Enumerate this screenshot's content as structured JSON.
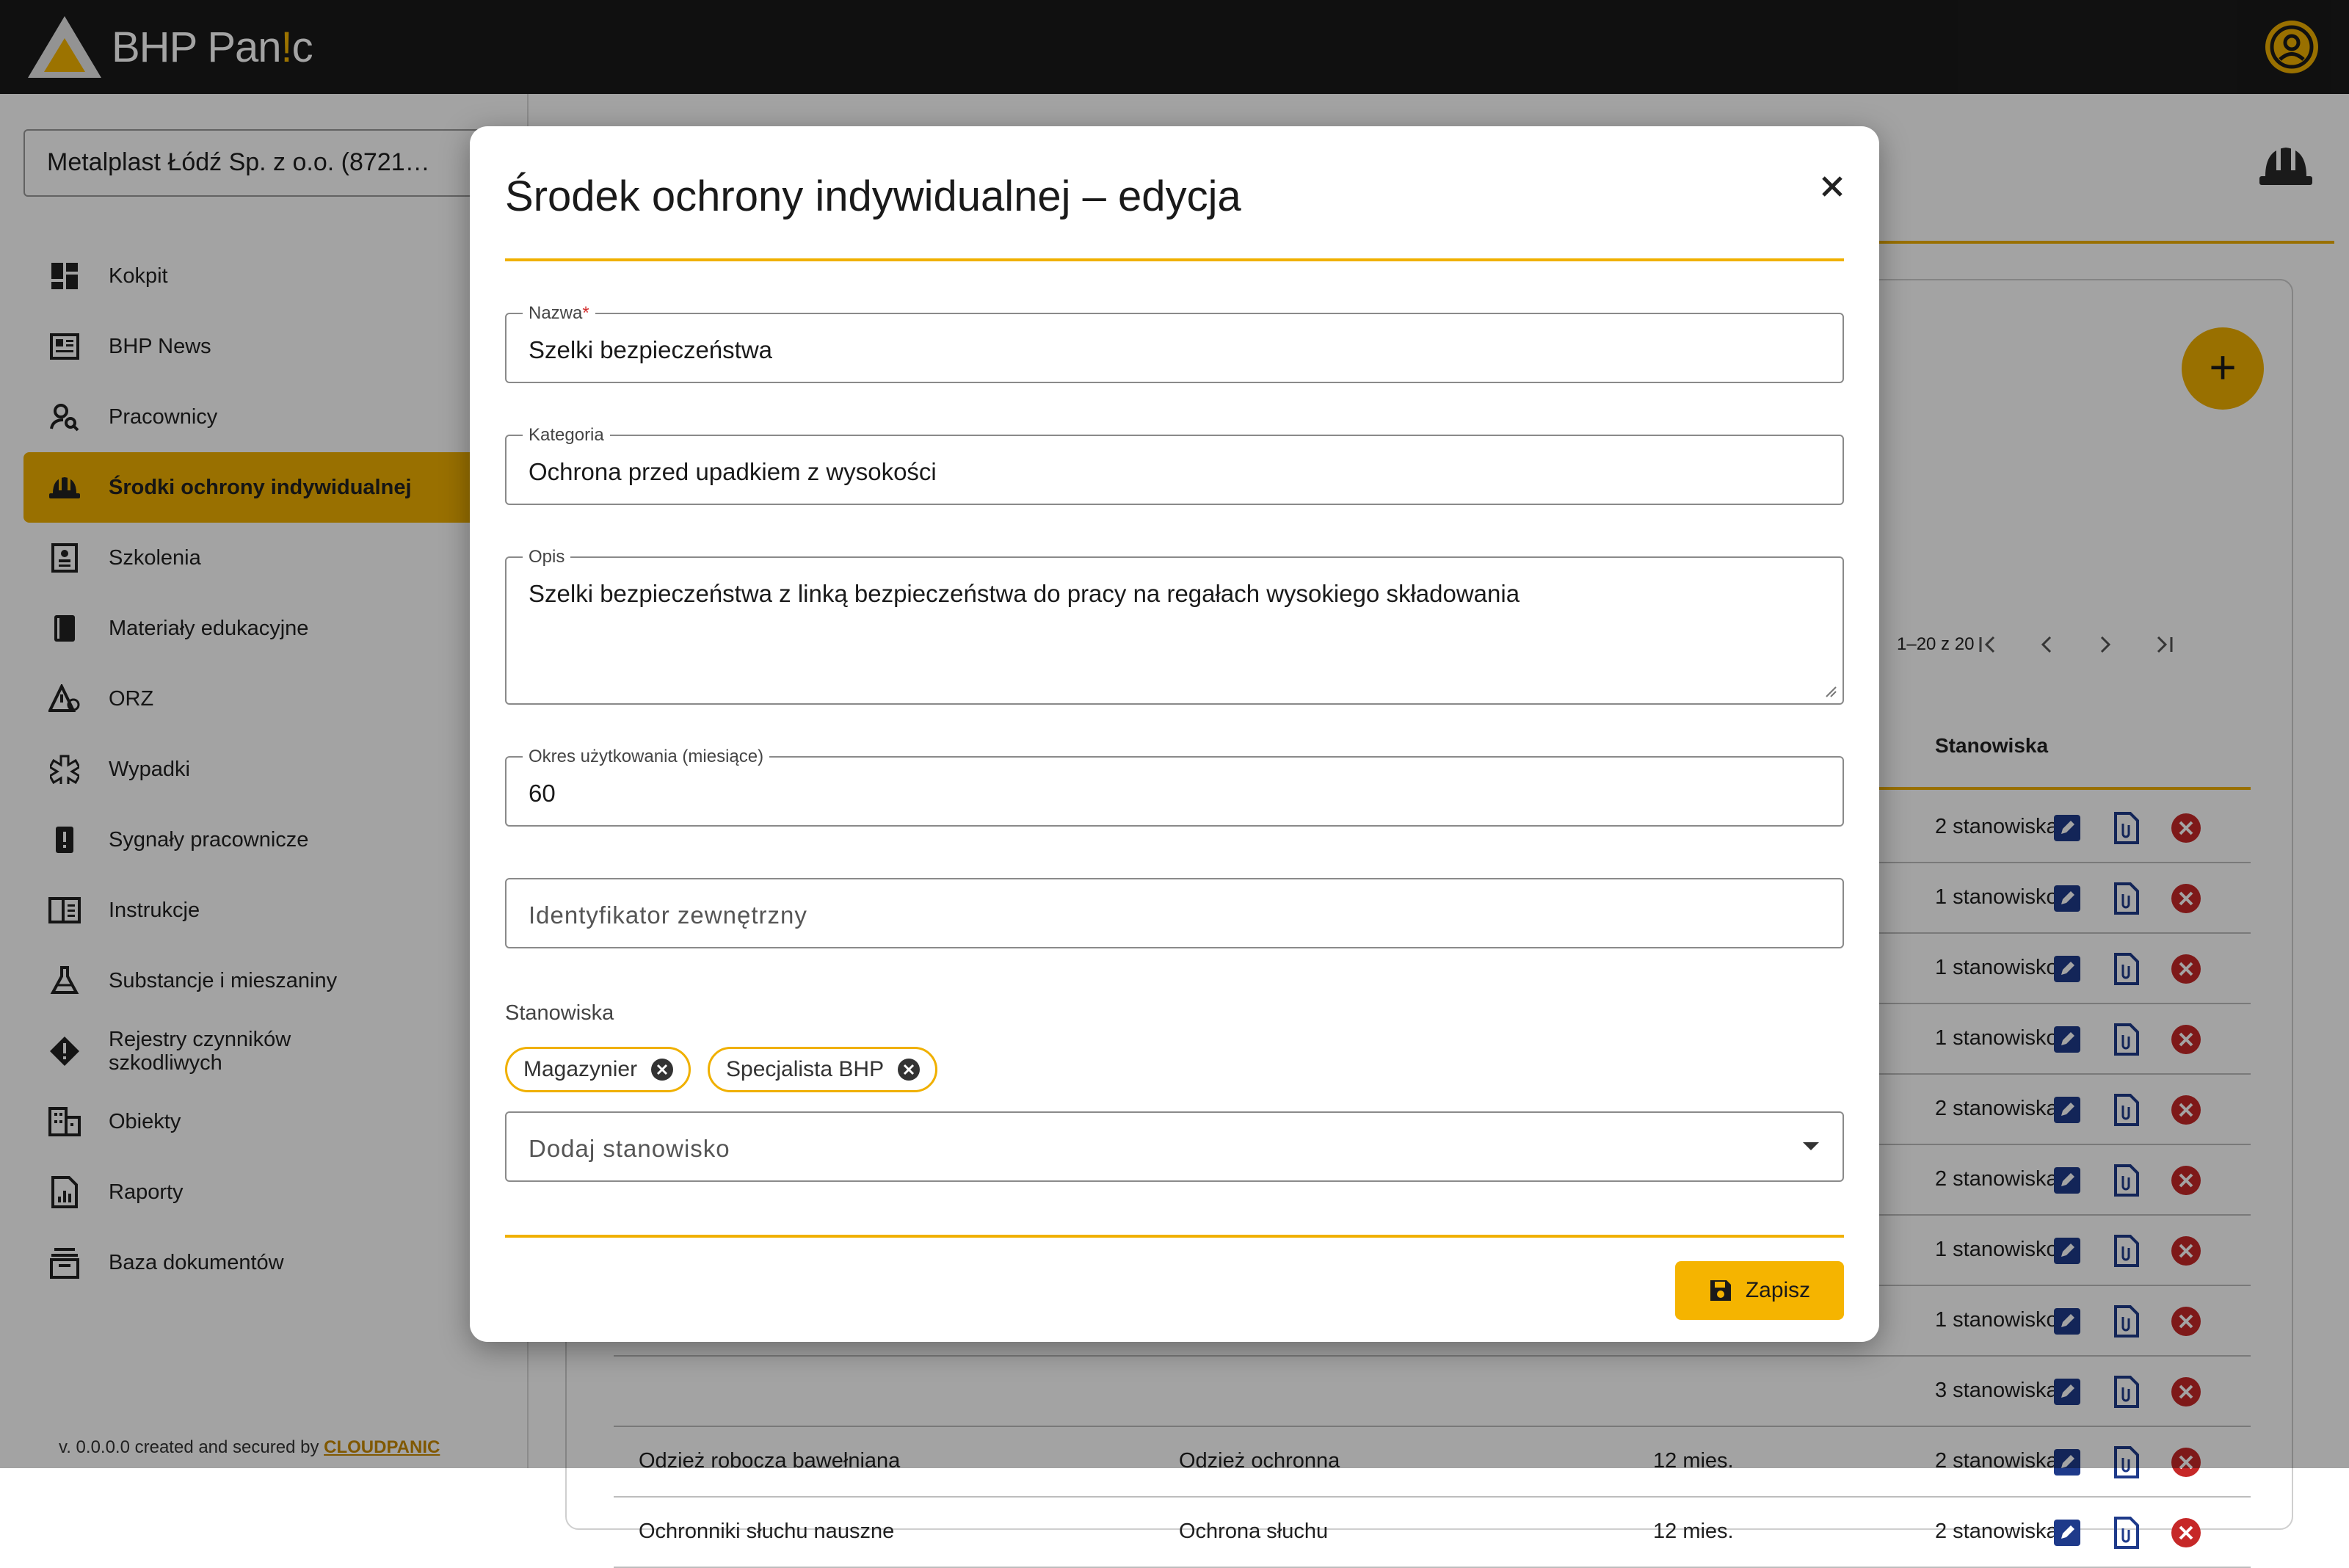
{
  "app": {
    "brand_prefix": "BHP Pan",
    "brand_mark": "!",
    "brand_suffix": "c"
  },
  "sidebar": {
    "company": "Metalplast Łódź Sp. z o.o. (8721…",
    "items": [
      {
        "label": "Kokpit",
        "icon": "dashboard-icon",
        "expandable": false
      },
      {
        "label": "BHP News",
        "icon": "newspaper-icon",
        "expandable": false
      },
      {
        "label": "Pracownicy",
        "icon": "person-search-icon",
        "expandable": true
      },
      {
        "label": "Środki ochrony indywidualnej",
        "icon": "hard-hat-icon",
        "expandable": false,
        "active": true
      },
      {
        "label": "Szkolenia",
        "icon": "training-icon",
        "expandable": true
      },
      {
        "label": "Materiały edukacyjne",
        "icon": "book-icon",
        "expandable": false
      },
      {
        "label": "ORZ",
        "icon": "risk-warning-icon",
        "expandable": true
      },
      {
        "label": "Wypadki",
        "icon": "medical-icon",
        "expandable": false
      },
      {
        "label": "Sygnały pracownicze",
        "icon": "alert-signal-icon",
        "expandable": false
      },
      {
        "label": "Instrukcje",
        "icon": "manual-icon",
        "expandable": false
      },
      {
        "label": "Substancje i mieszaniny",
        "icon": "flask-icon",
        "expandable": false
      },
      {
        "label": "Rejestry czynników szkodliwych",
        "icon": "hazard-register-icon",
        "expandable": false
      },
      {
        "label": "Obiekty",
        "icon": "building-icon",
        "expandable": true
      },
      {
        "label": "Raporty",
        "icon": "report-icon",
        "expandable": false
      },
      {
        "label": "Baza dokumentów",
        "icon": "archive-icon",
        "expandable": true
      }
    ],
    "version_text": "v. 0.0.0.0 created and secured by ",
    "version_brand": "CLOUDPANIC"
  },
  "list": {
    "pager_text": "1–20 z 20",
    "column_stanowiska": "Stanowiska",
    "rows": [
      {
        "name": "",
        "category": "",
        "period": "",
        "positions": "2 stanowiska"
      },
      {
        "name": "",
        "category": "",
        "period": "",
        "positions": "1 stanowisko"
      },
      {
        "name": "",
        "category": "",
        "period": "",
        "positions": "1 stanowisko"
      },
      {
        "name": "",
        "category": "",
        "period": "",
        "positions": "1 stanowisko"
      },
      {
        "name": "",
        "category": "",
        "period": "",
        "positions": "2 stanowiska"
      },
      {
        "name": "",
        "category": "",
        "period": "",
        "positions": "2 stanowiska"
      },
      {
        "name": "",
        "category": "",
        "period": "",
        "positions": "1 stanowisko"
      },
      {
        "name": "",
        "category": "",
        "period": "",
        "positions": "1 stanowisko"
      },
      {
        "name": "",
        "category": "",
        "period": "",
        "positions": "3 stanowiska"
      },
      {
        "name": "Odzież robocza bawełniana",
        "category": "Odzież ochronna",
        "period": "12 mies.",
        "positions": "2 stanowiska"
      },
      {
        "name": "Ochronniki słuchu nauszne",
        "category": "Ochrona słuchu",
        "period": "12 mies.",
        "positions": "2 stanowiska"
      }
    ]
  },
  "modal": {
    "title": "Środek ochrony indywidualnej – edycja",
    "name_label": "Nazwa",
    "name_required": "*",
    "name_value": "Szelki bezpieczeństwa",
    "category_label": "Kategoria",
    "category_value": "Ochrona przed upadkiem z wysokości",
    "description_label": "Opis",
    "description_value": "Szelki bezpieczeństwa z linką bezpieczeństwa do pracy na regałach wysokiego składowania",
    "period_label": "Okres użytkowania (miesiące)",
    "period_value": "60",
    "external_id_placeholder": "Identyfikator zewnętrzny",
    "positions_label": "Stanowiska",
    "chips": [
      "Magazynier",
      "Specjalista BHP"
    ],
    "add_position_placeholder": "Dodaj stanowisko",
    "save_label": "Zapisz"
  },
  "colors": {
    "accent": "#f0b000",
    "topbar": "#1a1a1a",
    "action_blue": "#1e3a8a",
    "delete_red": "#c62828"
  }
}
